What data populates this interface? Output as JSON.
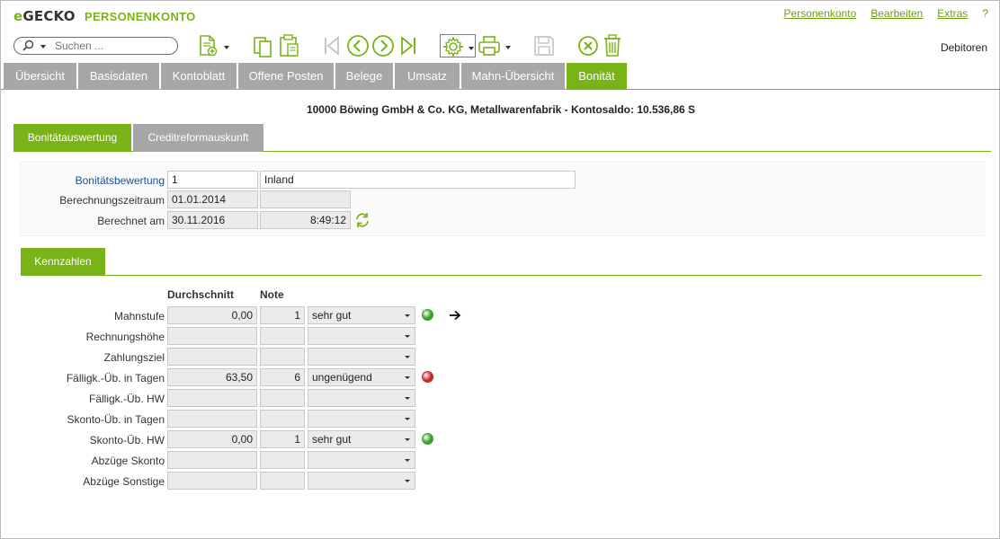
{
  "app": {
    "logo_e": "e",
    "logo_rest": "GECKO",
    "title": "PERSONENKONTO"
  },
  "top_menu": [
    "Personenkonto",
    "Bearbeiten",
    "Extras",
    "?"
  ],
  "toolbar": {
    "search_placeholder": "Suchen ...",
    "right_label": "Debitoren"
  },
  "tabs": [
    {
      "label": "Übersicht",
      "active": false
    },
    {
      "label": "Basisdaten",
      "active": false
    },
    {
      "label": "Kontoblatt",
      "active": false
    },
    {
      "label": "Offene Posten",
      "active": false
    },
    {
      "label": "Belege",
      "active": false
    },
    {
      "label": "Umsatz",
      "active": false
    },
    {
      "label": "Mahn-Übersicht",
      "active": false
    },
    {
      "label": "Bonität",
      "active": true
    }
  ],
  "account_line": "10000 Böwing GmbH & Co. KG, Metallwarenfabrik - Kontosaldo: 10.536,86 S",
  "subtabs": [
    {
      "label": "Bonitätauswertung",
      "active": true
    },
    {
      "label": "Creditreformauskunft",
      "active": false
    }
  ],
  "header_fields": {
    "bonitaet_label": "Bonitätsbewertung",
    "bonitaet_value": "1",
    "bonitaet_text": "Inland",
    "zeitraum_label": "Berechnungszeitraum",
    "zeitraum_value": "01.01.2014",
    "zeitraum_value2": "",
    "berechnet_label": "Berechnet am",
    "berechnet_date": "30.11.2016",
    "berechnet_time": "8:49:12"
  },
  "kennzahlen": {
    "tab_label": "Kennzahlen",
    "col_durchschnitt": "Durchschnitt",
    "col_note": "Note",
    "rows": [
      {
        "label": "Mahnstufe",
        "avg": "0,00",
        "note": "1",
        "rating": "sehr gut",
        "status": "green",
        "has_arrow": true
      },
      {
        "label": "Rechnungshöhe",
        "avg": "",
        "note": "",
        "rating": "",
        "status": "",
        "has_arrow": false
      },
      {
        "label": "Zahlungsziel",
        "avg": "",
        "note": "",
        "rating": "",
        "status": "",
        "has_arrow": false
      },
      {
        "label": "Fälligk.-Üb. in Tagen",
        "avg": "63,50",
        "note": "6",
        "rating": "ungenügend",
        "status": "red",
        "has_arrow": false
      },
      {
        "label": "Fälligk.-Üb. HW",
        "avg": "",
        "note": "",
        "rating": "",
        "status": "",
        "has_arrow": false
      },
      {
        "label": "Skonto-Üb. in Tagen",
        "avg": "",
        "note": "",
        "rating": "",
        "status": "",
        "has_arrow": false
      },
      {
        "label": "Skonto-Üb. HW",
        "avg": "0,00",
        "note": "1",
        "rating": "sehr gut",
        "status": "green",
        "has_arrow": false
      },
      {
        "label": "Abzüge Skonto",
        "avg": "",
        "note": "",
        "rating": "",
        "status": "",
        "has_arrow": false
      },
      {
        "label": "Abzüge Sonstige",
        "avg": "",
        "note": "",
        "rating": "",
        "status": "",
        "has_arrow": false
      }
    ]
  },
  "colors": {
    "accent": "#7ab317",
    "tab_inactive": "#a7a7a7",
    "status_green": "#3aa12a",
    "status_red": "#c8282c"
  },
  "icons": [
    "search-icon",
    "new-document-icon",
    "copy-icon",
    "paste-icon",
    "first-record-icon",
    "previous-record-icon",
    "next-record-icon",
    "last-record-icon",
    "settings-gear-icon",
    "print-icon",
    "save-icon",
    "cancel-icon",
    "delete-icon",
    "refresh-icon",
    "arrow-right-icon"
  ]
}
